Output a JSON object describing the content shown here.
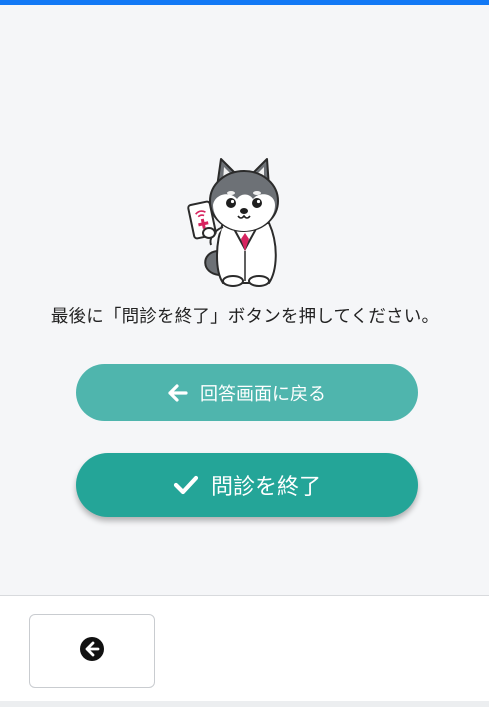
{
  "message": "最後に「問診を終了」ボタンを押してください。",
  "buttons": {
    "back_to_answers": {
      "label": "回答画面に戻る",
      "icon": "arrow-left-icon"
    },
    "finish": {
      "label": "問診を終了",
      "icon": "check-icon"
    }
  },
  "footer": {
    "back_icon": "circle-arrow-left-icon"
  },
  "colors": {
    "top_bar": "#1279f5",
    "back_button": "#4fb5ad",
    "finish_button": "#24a598",
    "background": "#f5f6f8"
  }
}
